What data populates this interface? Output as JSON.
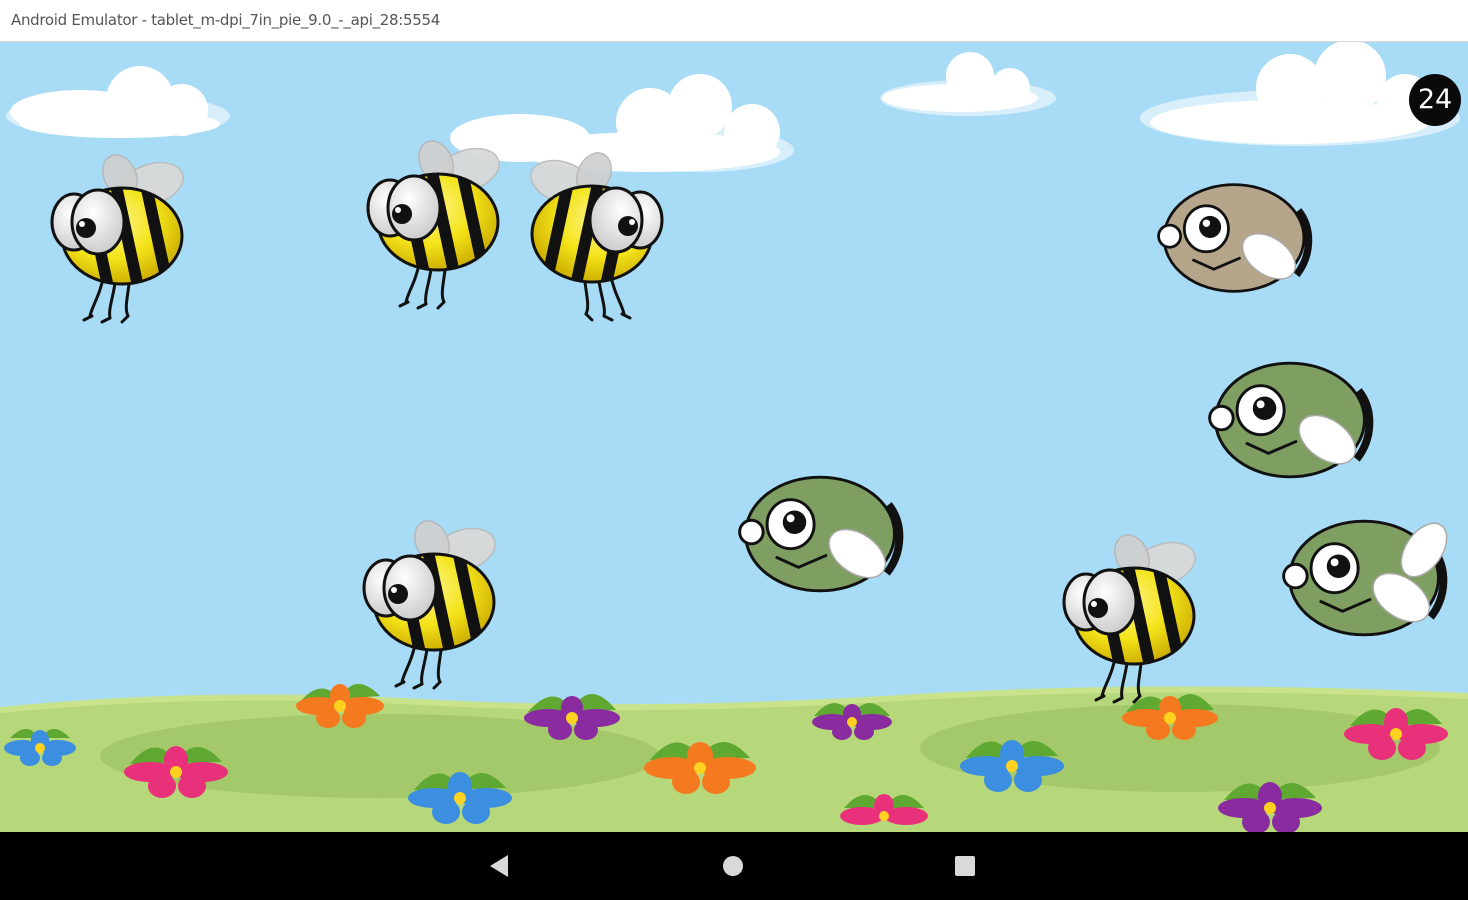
{
  "window": {
    "title": "Android Emulator - tablet_m-dpi_7in_pie_9.0_-_api_28:5554"
  },
  "game": {
    "score": "24",
    "characters": [
      {
        "kind": "bee",
        "facing": "left"
      },
      {
        "kind": "bee",
        "facing": "left"
      },
      {
        "kind": "bee",
        "facing": "right"
      },
      {
        "kind": "fly",
        "color": "brown"
      },
      {
        "kind": "fly",
        "color": "green"
      },
      {
        "kind": "fly",
        "color": "green"
      },
      {
        "kind": "bee",
        "facing": "left"
      },
      {
        "kind": "bee",
        "facing": "left"
      },
      {
        "kind": "fly",
        "color": "green"
      }
    ],
    "colors": {
      "sky": "#a8dcf6",
      "grass": "#b7d87a",
      "bee_yellow": "#f4e419",
      "fly_green": "#7f9e62",
      "fly_brown": "#b5a58a",
      "score_bg": "#0a0a0a"
    }
  },
  "navbar": {
    "back_icon": "back-triangle-icon",
    "home_icon": "home-circle-icon",
    "recents_icon": "recents-square-icon"
  }
}
